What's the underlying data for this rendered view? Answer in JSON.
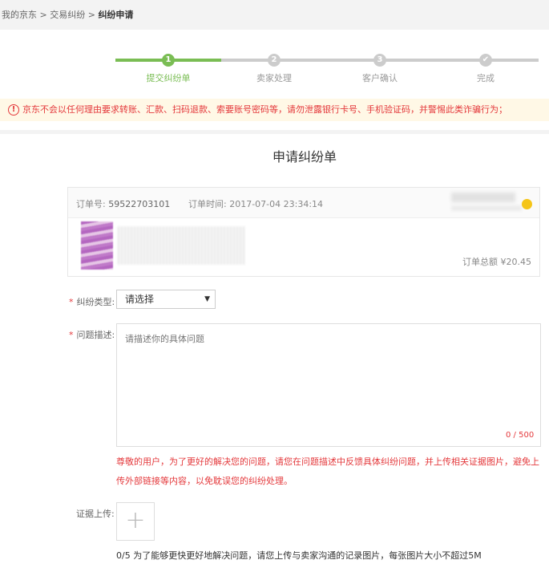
{
  "breadcrumb": {
    "home": "我的京东",
    "sep": " > ",
    "mid": "交易纠纷",
    "current": "纠纷申请"
  },
  "steps": [
    {
      "num": "1",
      "label": "提交纠纷单"
    },
    {
      "num": "2",
      "label": "卖家处理"
    },
    {
      "num": "3",
      "label": "客户确认"
    },
    {
      "num": "✔",
      "label": "完成"
    }
  ],
  "warning": {
    "icon": "!",
    "text": "京东不会以任何理由要求转账、汇款、扫码退款、索要账号密码等，请勿泄露银行卡号、手机验证码，并警惕此类诈骗行为；"
  },
  "form": {
    "title": "申请纠纷单"
  },
  "order": {
    "number_label": "订单号:",
    "number": "59522703101",
    "time_label": "订单时间:",
    "time": "2017-07-04 23:34:14",
    "total_label": "订单总额",
    "total": "¥20.45"
  },
  "dispute_type": {
    "label": "纠纷类型:",
    "value": "请选择",
    "arrow": "▼"
  },
  "description": {
    "label": "问题描述:",
    "placeholder": "请描述你的具体问题",
    "counter": "0 / 500"
  },
  "tip": "尊敬的用户，为了更好的解决您的问题，请您在问题描述中反馈具体纠纷问题，并上传相关证据图片，避免上传外部链接等内容，以免耽误您的纠纷处理。",
  "evidence": {
    "label": "证据上传:",
    "plus": "+",
    "tip": "0/5 为了能够更快更好地解决问题，请您上传与卖家沟通的记录图片，每张图片大小不超过5M"
  },
  "colors": {
    "accent": "#7abd54",
    "danger": "#e4393c"
  }
}
